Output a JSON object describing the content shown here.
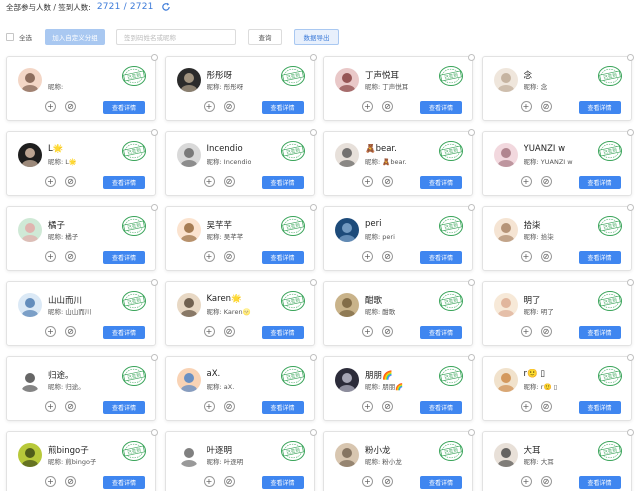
{
  "header": {
    "stats_label": "全部参与人数 / 签到人数:",
    "stats_value": "2721 / 2721",
    "refresh_icon": "refresh-icon"
  },
  "toolbar": {
    "select_all_label": "全选",
    "group_button_label": "加入自定义分组",
    "search_placeholder": "签到码姓名或昵称",
    "query_button_label": "查询",
    "export_button_label": "数据导出"
  },
  "card_common": {
    "nickname_prefix": "昵称:",
    "detail_button_label": "查看详情",
    "stamp_text": "已签到",
    "plus_icon": "plus-icon",
    "ban_icon": "ban-icon"
  },
  "colors": {
    "accent": "#3f86f0",
    "stamp_green": "#3aa45a",
    "muted_button": "#a9c8f1"
  },
  "participants": [
    {
      "name": "",
      "nickname": ""
    },
    {
      "name": "彤彤呀",
      "nickname": "彤彤呀"
    },
    {
      "name": "丁声悦耳",
      "nickname": "丁声悦耳"
    },
    {
      "name": "念",
      "nickname": "念"
    },
    {
      "name": "L🌟",
      "nickname": "L🌟"
    },
    {
      "name": "Incendio",
      "nickname": "Incendio"
    },
    {
      "name": "🧸bear.",
      "nickname": "🧸bear."
    },
    {
      "name": "YUANZI w",
      "nickname": "YUANZI w"
    },
    {
      "name": "橘子",
      "nickname": "橘子"
    },
    {
      "name": "吴芊芊",
      "nickname": "吴芊芊"
    },
    {
      "name": "peri",
      "nickname": "peri"
    },
    {
      "name": "拾柒",
      "nickname": "拾柒"
    },
    {
      "name": "山山而川",
      "nickname": "山山而川"
    },
    {
      "name": "Karen🌟",
      "nickname": "Karen🌝"
    },
    {
      "name": "酣歌",
      "nickname": "酣歌"
    },
    {
      "name": "明了",
      "nickname": "明了"
    },
    {
      "name": "归途。",
      "nickname": "归途。"
    },
    {
      "name": "aX.",
      "nickname": "aX."
    },
    {
      "name": "朋朋🌈",
      "nickname": "朋朋🌈"
    },
    {
      "name": "r🙂 ▯",
      "nickname": "r🙂 ▯"
    },
    {
      "name": "煎bingo子",
      "nickname": "煎bingo子"
    },
    {
      "name": "叶逐明",
      "nickname": "叶逐明"
    },
    {
      "name": "粉小龙",
      "nickname": "粉小龙"
    },
    {
      "name": "大耳",
      "nickname": "大耳"
    }
  ]
}
